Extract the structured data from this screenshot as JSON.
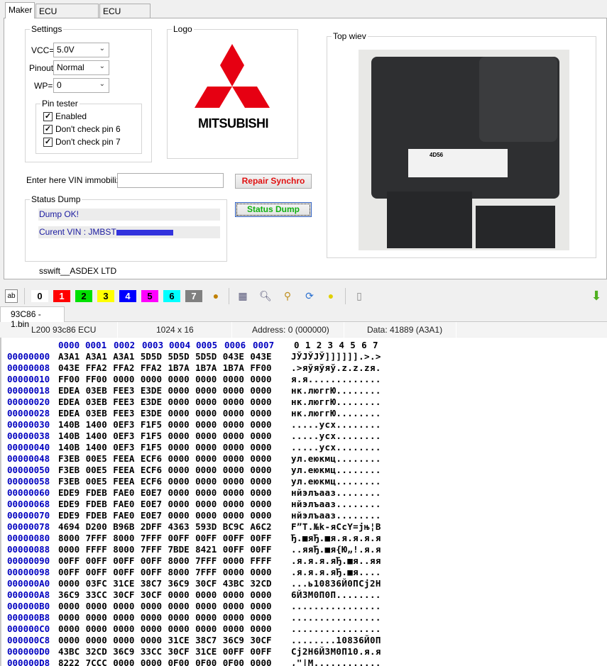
{
  "tabs": [
    "Maker",
    "ECU connection",
    "ECU location"
  ],
  "settings": {
    "title": "Settings",
    "vcc_label": "VCC=",
    "vcc_value": "5.0V",
    "pinout_label": "Pinout",
    "pinout_value": "Normal",
    "wp_label": "WP=",
    "wp_value": "0",
    "pin_tester": {
      "title": "Pin tester",
      "options": [
        {
          "label": "Enabled",
          "checked": true
        },
        {
          "label": "Don't check pin 6",
          "checked": true
        },
        {
          "label": "Don't check pin 7",
          "checked": true
        }
      ]
    }
  },
  "logo": {
    "title": "Logo",
    "brand": "MITSUBISHI",
    "color": "#e60012"
  },
  "top_view": {
    "title": "Top wiev",
    "ecu_label": "4D56"
  },
  "vin": {
    "label": "Enter here VIN immobilizer",
    "value": ""
  },
  "buttons": {
    "repair": "Repair Synchro",
    "repair_color": "#e01010",
    "status_dump": "Status Dump",
    "status_dump_color": "#10b010"
  },
  "status_dump": {
    "title": "Status Dump",
    "lines": [
      "Dump OK!",
      "Curent VIN : JMBST"
    ]
  },
  "footer": "sswift__ASDEX LTD",
  "toolbar": {
    "colors": [
      {
        "label": "0",
        "bg": "#ffffff",
        "fg": "#000"
      },
      {
        "label": "1",
        "bg": "#ff0000",
        "fg": "#fff"
      },
      {
        "label": "2",
        "bg": "#00e000",
        "fg": "#000"
      },
      {
        "label": "3",
        "bg": "#ffff00",
        "fg": "#000"
      },
      {
        "label": "4",
        "bg": "#0000ff",
        "fg": "#fff"
      },
      {
        "label": "5",
        "bg": "#ff00ff",
        "fg": "#000"
      },
      {
        "label": "6",
        "bg": "#00ffff",
        "fg": "#000"
      },
      {
        "label": "7",
        "bg": "#808080",
        "fg": "#fff"
      }
    ],
    "icons": [
      "ab-case-icon",
      "palette-icon",
      "calculator-icon",
      "find-icon",
      "broom-icon",
      "refresh-icon",
      "lightbulb-icon",
      "new-file-icon",
      "download-arrow-icon"
    ]
  },
  "file_tab": "93C86 - 1.bin",
  "info": {
    "device": "L200 93c86 ECU",
    "size": "1024 x 16",
    "address": "Address: 0 (000000)",
    "data": "Data: 41889 (A3A1)"
  },
  "hex": {
    "header_cols": [
      "0000",
      "0001",
      "0002",
      "0003",
      "0004",
      "0005",
      "0006",
      "0007"
    ],
    "header_ascii": "0 1 2 3 4 5 6 7",
    "rows": [
      [
        "00000000",
        "A3A1 A3A1 A3A1 5D5D 5D5D 5D5D 043E 043E",
        "JЎJЎJЎ]]]]]].>.>"
      ],
      [
        "00000008",
        "043E FFA2 FFA2 FFA2 1B7A 1B7A 1B7A FF00",
        ".>яўяўяў.z.z.zя."
      ],
      [
        "00000010",
        "FF00 FF00 0000 0000 0000 0000 0000 0000",
        "я.я............."
      ],
      [
        "00000018",
        "EDEA 03EB FEE3 E3DE 0000 0000 0000 0000",
        "нк.люггЮ........"
      ],
      [
        "00000020",
        "EDEA 03EB FEE3 E3DE 0000 0000 0000 0000",
        "нк.люггЮ........"
      ],
      [
        "00000028",
        "EDEA 03EB FEE3 E3DE 0000 0000 0000 0000",
        "нк.люггЮ........"
      ],
      [
        "00000030",
        "140B 1400 0EF3 F1F5 0000 0000 0000 0000",
        ".....усх........"
      ],
      [
        "00000038",
        "140B 1400 0EF3 F1F5 0000 0000 0000 0000",
        ".....усх........"
      ],
      [
        "00000040",
        "140B 1400 0EF3 F1F5 0000 0000 0000 0000",
        ".....усх........"
      ],
      [
        "00000048",
        "F3EB 00E5 FEEA ECF6 0000 0000 0000 0000",
        "ул.еюкмц........"
      ],
      [
        "00000050",
        "F3EB 00E5 FEEA ECF6 0000 0000 0000 0000",
        "ул.еюкмц........"
      ],
      [
        "00000058",
        "F3EB 00E5 FEEA ECF6 0000 0000 0000 0000",
        "ул.еюкмц........"
      ],
      [
        "00000060",
        "EDE9 FDEB FAE0 E0E7 0000 0000 0000 0000",
        "нйэлъааз........"
      ],
      [
        "00000068",
        "EDE9 FDEB FAE0 E0E7 0000 0000 0000 0000",
        "нйэлъааз........"
      ],
      [
        "00000070",
        "EDE9 FDEB FAE0 E0E7 0000 0000 0000 0000",
        "нйэлъааз........"
      ],
      [
        "00000078",
        "4694 D200 B96B 2DFF 4363 593D BC9C A6C2",
        "F”T.№k-яCcY=jњ¦B"
      ],
      [
        "00000080",
        "8000 7FFF 8000 7FFF 00FF 00FF 00FF 00FF",
        "Ђ.■яЂ.■я.я.я.я.я"
      ],
      [
        "00000088",
        "0000 FFFF 8000 7FFF 7BDE 8421 00FF 00FF",
        "..яяЂ.■я{Ю„!.я.я"
      ],
      [
        "00000090",
        "00FF 00FF 00FF 00FF 8000 7FFF 0000 FFFF",
        ".я.я.я.яЂ.■я..яя"
      ],
      [
        "00000098",
        "00FF 00FF 00FF 00FF 8000 7FFF 0000 0000",
        ".я.я.я.яЂ.■я...."
      ],
      [
        "000000A0",
        "0000 03FC 31CE 38C7 36C9 30CF 43BC 32CD",
        "...ь10836Й0ПCj2Н"
      ],
      [
        "000000A8",
        "36C9 33CC 30CF 30CF 0000 0000 0000 0000",
        "6Й3М0П0П........"
      ],
      [
        "000000B0",
        "0000 0000 0000 0000 0000 0000 0000 0000",
        "................"
      ],
      [
        "000000B8",
        "0000 0000 0000 0000 0000 0000 0000 0000",
        "................"
      ],
      [
        "000000C0",
        "0000 0000 0000 0000 0000 0000 0000 0000",
        "................"
      ],
      [
        "000000C8",
        "0000 0000 0000 0000 31CE 38C7 36C9 30CF",
        "........10836Й0П"
      ],
      [
        "000000D0",
        "43BC 32CD 36C9 33CC 30CF 31CE 00FF 00FF",
        "Cj2Н6Й3М0П10.я.я"
      ],
      [
        "000000D8",
        "8222 7CCC 0000 0000 0F00 0F00 0F00 0000",
        "‚\"|М............"
      ]
    ]
  }
}
